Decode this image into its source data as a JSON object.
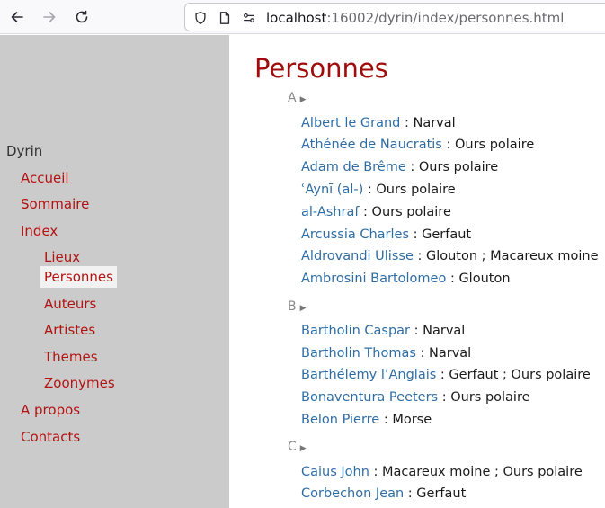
{
  "browser": {
    "url_host": "localhost",
    "url_rest": ":16002/dyrin/index/personnes.html"
  },
  "sidebar": {
    "title": "Dyrin",
    "items": [
      {
        "label": "Accueil"
      },
      {
        "label": "Sommaire"
      },
      {
        "label": "Index"
      },
      {
        "label": "Lieux"
      },
      {
        "label": "Personnes"
      },
      {
        "label": "Auteurs"
      },
      {
        "label": "Artistes"
      },
      {
        "label": "Themes"
      },
      {
        "label": "Zoonymes"
      },
      {
        "label": "A propos"
      },
      {
        "label": "Contacts"
      }
    ]
  },
  "main": {
    "title": "Personnes",
    "groups": [
      {
        "letter": "A",
        "entries": [
          {
            "name": "Albert le Grand",
            "animals": " : Narval"
          },
          {
            "name": "Athénée de Naucratis",
            "animals": " : Ours polaire"
          },
          {
            "name": "Adam de Brême",
            "animals": " : Ours polaire"
          },
          {
            "name": "ʿAynī (al-)",
            "animals": " : Ours polaire"
          },
          {
            "name": "al-Ashraf",
            "animals": " : Ours polaire"
          },
          {
            "name": "Arcussia Charles",
            "animals": " : Gerfaut"
          },
          {
            "name": "Aldrovandi Ulisse",
            "animals": " : Glouton ; Macareux moine"
          },
          {
            "name": "Ambrosini Bartolomeo",
            "animals": " : Glouton"
          }
        ]
      },
      {
        "letter": "B",
        "entries": [
          {
            "name": "Bartholin Caspar",
            "animals": " : Narval"
          },
          {
            "name": "Bartholin Thomas",
            "animals": " : Narval"
          },
          {
            "name": "Barthélemy l’Anglais",
            "animals": " : Gerfaut ; Ours polaire"
          },
          {
            "name": "Bonaventura Peeters",
            "animals": " : Ours polaire"
          },
          {
            "name": "Belon Pierre",
            "animals": " : Morse"
          }
        ]
      },
      {
        "letter": "C",
        "entries": [
          {
            "name": "Caius John",
            "animals": " : Macareux moine ; Ours polaire"
          },
          {
            "name": "Corbechon Jean",
            "animals": " : Gerfaut"
          }
        ]
      }
    ]
  }
}
